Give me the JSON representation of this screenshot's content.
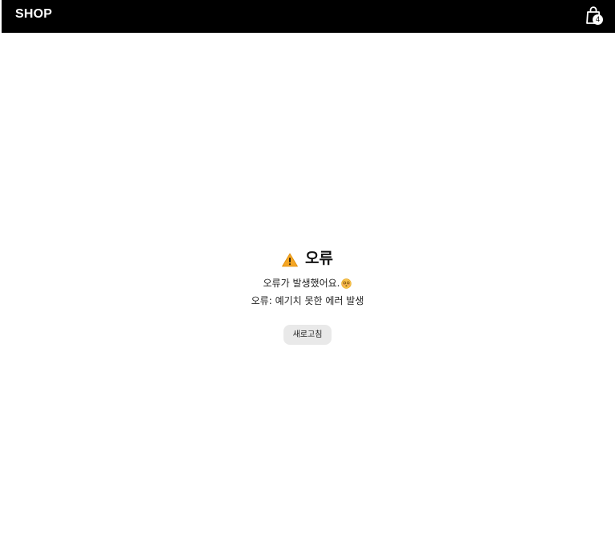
{
  "header": {
    "logo": "SHOP",
    "cart_count": "4",
    "cart_icon": "shopping-bag-icon"
  },
  "error": {
    "icon": "warning-icon",
    "title": "오류",
    "message": "오류가 발생했어요.",
    "message_emoji": "dizzy-face-emoji",
    "detail": "오류: 예기치 못한 에러 발생",
    "refresh_label": "새로고침"
  },
  "colors": {
    "header_bg": "#000000",
    "warning": "#f5a623",
    "button_bg": "#e9e9e9"
  }
}
